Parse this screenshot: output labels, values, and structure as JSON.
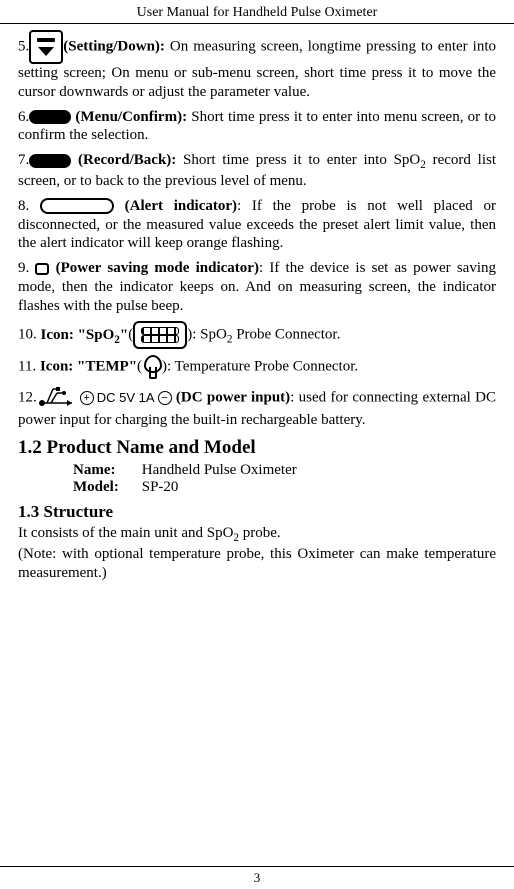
{
  "header": "User Manual for Handheld Pulse Oximeter",
  "page_number": "3",
  "items": {
    "i5": {
      "num": "5.",
      "label": "(Setting/Down):",
      "text": " On measuring screen, longtime pressing to enter into setting screen; On menu or sub-menu screen, short time press it to move the cursor downwards or adjust the parameter value."
    },
    "i6": {
      "num": "6.",
      "label": " (Menu/Confirm):",
      "text": " Short time press it to enter into menu screen, or to confirm the selection."
    },
    "i7": {
      "num": "7.",
      "label": " (Record/Back):",
      "text": " Short time press it to enter into SpO",
      "text_after_sub": " record list screen, or to back to the previous level of menu."
    },
    "i8": {
      "num": "8. ",
      "label": " (Alert indicator)",
      "text": ": If the probe is not well placed or disconnected, or the measured value exceeds the preset alert limit value, then the alert indicator will keep orange flashing."
    },
    "i9": {
      "num": "9. ",
      "label": " (Power saving mode indicator)",
      "text": ": If the device is set as power saving mode, then the indicator keeps on. And on measuring screen, the indicator flashes with the pulse beep."
    },
    "i10": {
      "num": "10.  ",
      "label_pre": "Icon: \"SpO",
      "label_post": "\"",
      "text": "): SpO",
      "text_after": " Probe Connector."
    },
    "i11": {
      "num": "11.  ",
      "label": "Icon: \"TEMP\"",
      "text": "): Temperature Probe Connector."
    },
    "i12": {
      "num": "12.",
      "dc_text": "DC 5V 1A",
      "label": " (DC power input)",
      "text": ": used for connecting external DC power input for charging the built-in rechargeable battery."
    }
  },
  "section12": {
    "heading": "1.2 Product Name and Model",
    "name_label": "Name:",
    "name_value": "Handheld Pulse Oximeter",
    "model_label": "Model:",
    "model_value": " SP-20"
  },
  "section13": {
    "heading": "1.3 Structure",
    "line1_pre": "It consists of the main unit and SpO",
    "line1_post": " probe.",
    "line2": "(Note: with optional temperature probe, this Oximeter can make temperature measurement.)"
  },
  "sub2": "2"
}
